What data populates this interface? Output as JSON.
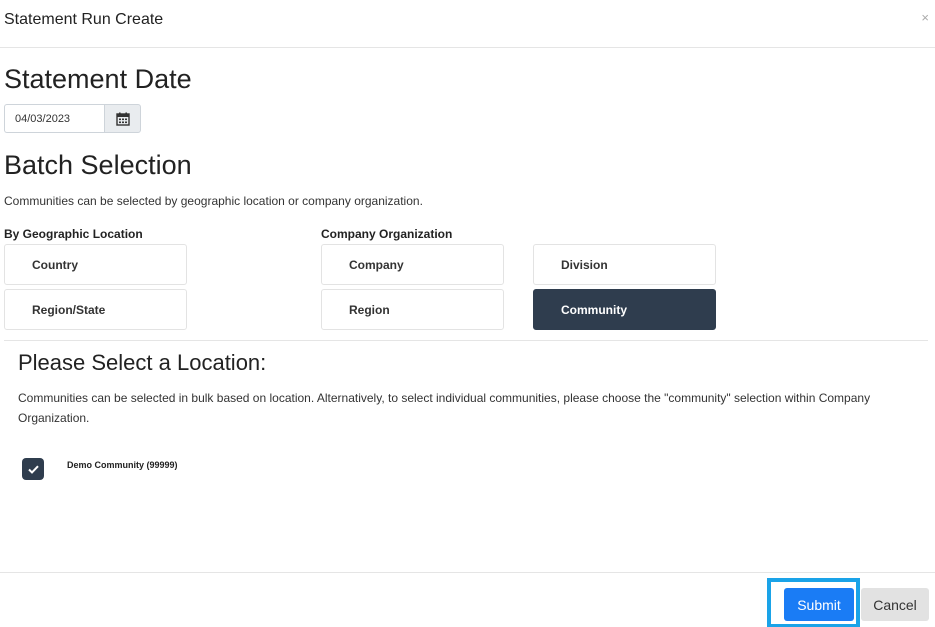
{
  "modal": {
    "title": "Statement Run Create",
    "close_label": "×"
  },
  "statement_date": {
    "heading": "Statement Date",
    "value": "04/03/2023",
    "calendar_icon": "calendar-icon"
  },
  "batch": {
    "heading": "Batch Selection",
    "description": "Communities can be selected by geographic location or company organization.",
    "geographic": {
      "label": "By Geographic Location",
      "options": [
        "Country",
        "Region/State"
      ]
    },
    "company": {
      "label": "Company Organization",
      "options": [
        "Company",
        "Division",
        "Region",
        "Community"
      ]
    },
    "selected": "Community"
  },
  "location": {
    "heading": "Please Select a Location:",
    "description": "Communities can be selected in bulk based on location. Alternatively, to select individual communities, please choose the \"community\" selection within Company Organization.",
    "items": [
      {
        "label": "Demo Community (99999)",
        "checked": true
      }
    ]
  },
  "footer": {
    "submit_label": "Submit",
    "cancel_label": "Cancel"
  },
  "colors": {
    "active": "#2f3d4e",
    "primary": "#1a7cf5",
    "focus": "#1aa3e8"
  }
}
